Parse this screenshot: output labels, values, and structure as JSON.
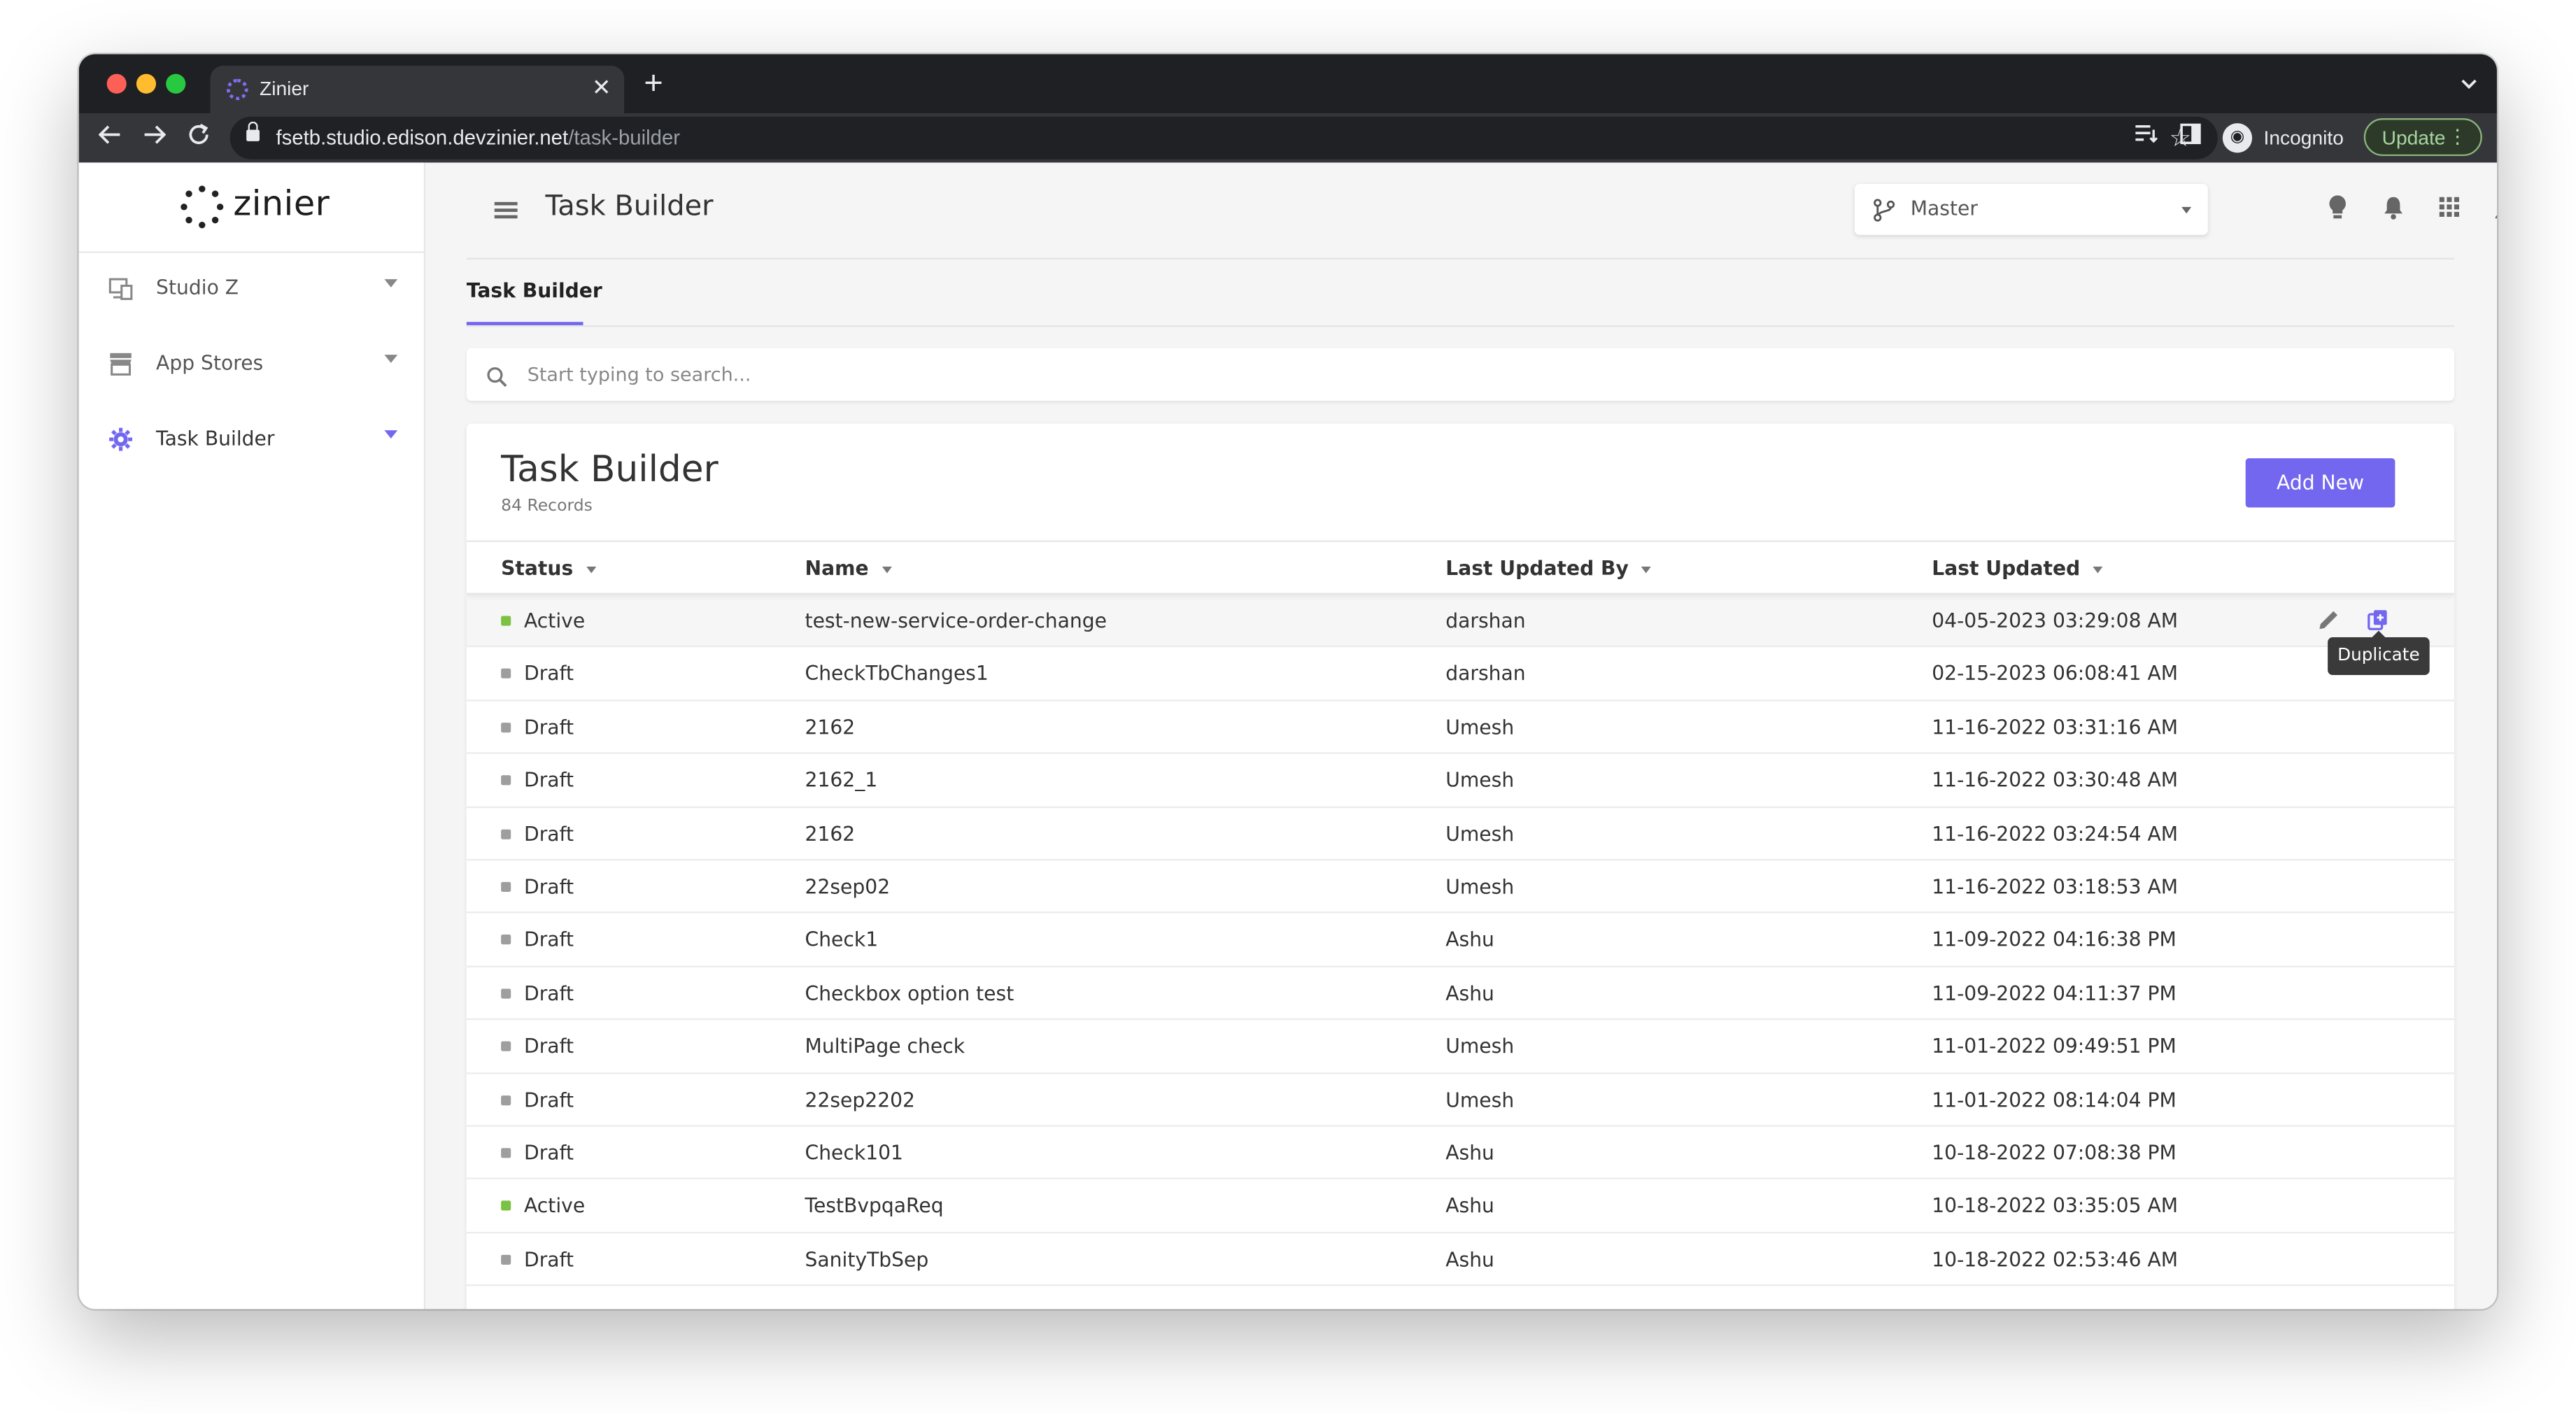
{
  "browser": {
    "tab_title": "Zinier",
    "tab_close": "✕",
    "new_tab": "+",
    "url_host": "fsetb.studio.edison.devzinier.net",
    "url_path": "/task-builder",
    "incognito_label": "Incognito",
    "update_label": "Update"
  },
  "sidebar": {
    "logo_text": "zinier",
    "items": [
      {
        "label": "Studio Z",
        "icon": "monitor-icon"
      },
      {
        "label": "App Stores",
        "icon": "store-icon"
      },
      {
        "label": "Task Builder",
        "icon": "gear-icon"
      }
    ]
  },
  "header": {
    "title": "Task Builder",
    "branch_selected": "Master"
  },
  "tabs": {
    "active": "Task Builder"
  },
  "search": {
    "placeholder": "Start typing to search..."
  },
  "card": {
    "title": "Task Builder",
    "count": "84 Records",
    "add_label": "Add New"
  },
  "table": {
    "columns": [
      "Status",
      "Name",
      "Last Updated By",
      "Last Updated"
    ],
    "rows": [
      {
        "status": "Active",
        "name": "test-new-service-order-change",
        "by": "darshan",
        "updated": "04-05-2023 03:29:08 AM"
      },
      {
        "status": "Draft",
        "name": "CheckTbChanges1",
        "by": "darshan",
        "updated": "02-15-2023 06:08:41 AM"
      },
      {
        "status": "Draft",
        "name": "2162",
        "by": "Umesh",
        "updated": "11-16-2022 03:31:16 AM"
      },
      {
        "status": "Draft",
        "name": "2162_1",
        "by": "Umesh",
        "updated": "11-16-2022 03:30:48 AM"
      },
      {
        "status": "Draft",
        "name": "2162",
        "by": "Umesh",
        "updated": "11-16-2022 03:24:54 AM"
      },
      {
        "status": "Draft",
        "name": "22sep02",
        "by": "Umesh",
        "updated": "11-16-2022 03:18:53 AM"
      },
      {
        "status": "Draft",
        "name": "Check1",
        "by": "Ashu",
        "updated": "11-09-2022 04:16:38 PM"
      },
      {
        "status": "Draft",
        "name": "Checkbox option test",
        "by": "Ashu",
        "updated": "11-09-2022 04:11:37 PM"
      },
      {
        "status": "Draft",
        "name": "MultiPage check",
        "by": "Umesh",
        "updated": "11-01-2022 09:49:51 PM"
      },
      {
        "status": "Draft",
        "name": "22sep2202",
        "by": "Umesh",
        "updated": "11-01-2022 08:14:04 PM"
      },
      {
        "status": "Draft",
        "name": "Check101",
        "by": "Ashu",
        "updated": "10-18-2022 07:08:38 PM"
      },
      {
        "status": "Active",
        "name": "TestBvpqaReq",
        "by": "Ashu",
        "updated": "10-18-2022 03:35:05 AM"
      },
      {
        "status": "Draft",
        "name": "SanityTbSep",
        "by": "Ashu",
        "updated": "10-18-2022 02:53:46 AM"
      }
    ],
    "tooltip": "Duplicate"
  },
  "colors": {
    "accent": "#7367f0",
    "active_status": "#7cc242",
    "draft_status": "#9e9e9e"
  }
}
